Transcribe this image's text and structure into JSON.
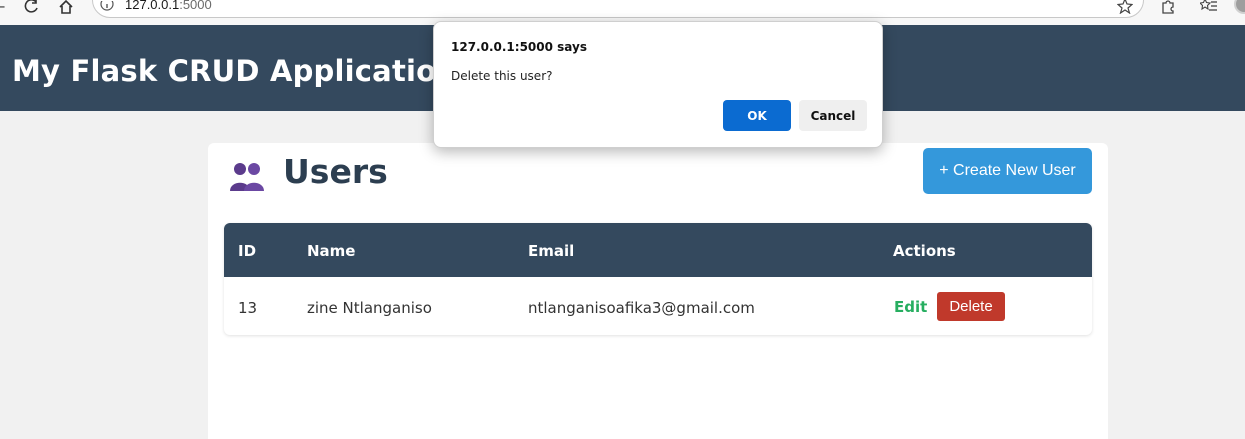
{
  "browser": {
    "url_host": "127.0.0.1",
    "url_port": ":5000",
    "icons": [
      "back-icon",
      "reload-icon",
      "home-icon",
      "info-icon",
      "star-icon",
      "extensions-icon",
      "favorites-icon",
      "avatar"
    ]
  },
  "header": {
    "title": "My Flask CRUD Application",
    "background": "#34495e"
  },
  "page": {
    "heading": "Users",
    "heading_icon": "users-icon",
    "create_button": "+ Create New User",
    "accent": "#3498db"
  },
  "table": {
    "columns": [
      "ID",
      "Name",
      "Email",
      "Actions"
    ],
    "rows": [
      {
        "id": "13",
        "name": "zine Ntlanganiso",
        "email": "ntlanganisoafika3@gmail.com",
        "edit_label": "Edit",
        "delete_label": "Delete"
      }
    ],
    "edit_color": "#27ae60",
    "delete_color": "#c0392b"
  },
  "dialog": {
    "title": "127.0.0.1:5000 says",
    "message": "Delete this user?",
    "ok_label": "OK",
    "cancel_label": "Cancel",
    "ok_color": "#0b6bd1"
  }
}
